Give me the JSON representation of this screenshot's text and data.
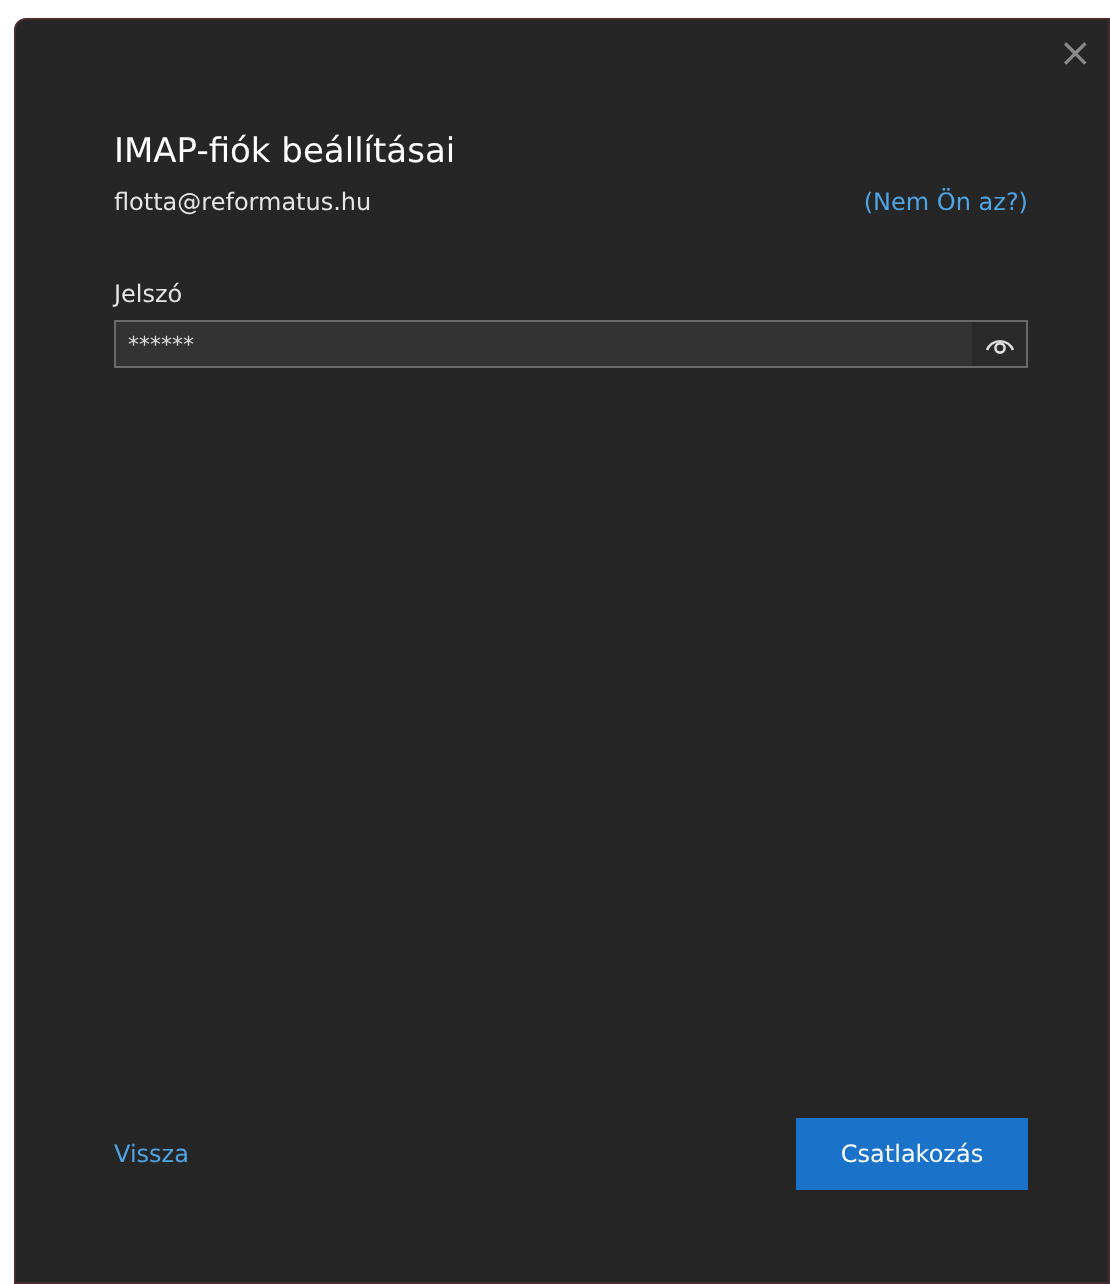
{
  "dialog": {
    "close": "×",
    "title": "IMAP-fiók beállításai",
    "email": "flotta@reformatus.hu",
    "not_you_link": "(Nem Ön az?)",
    "password": {
      "label": "Jelszó",
      "value": "******",
      "revealed": false
    },
    "back_link": "Vissza",
    "connect_button": "Csatlakozás"
  }
}
